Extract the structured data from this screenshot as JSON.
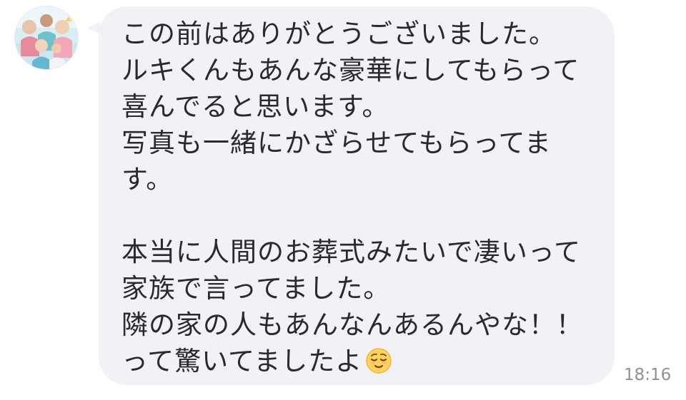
{
  "message": {
    "lines": [
      "この前はありがとうございました。",
      "ルキくんもあんな豪華にしてもらって",
      "喜んでると思います。",
      "写真も一緒にかざらせてもらってま",
      "す。",
      "",
      "本当に人間のお葬式みたいで凄いって",
      "家族で言ってました。",
      "隣の家の人もあんなんあるんやな！！",
      "って驚いてましたよ"
    ],
    "trailing_icon": "relieved-face-emoji",
    "timestamp": "18:16"
  },
  "colors": {
    "bubble": "#f1f2f5",
    "text": "#282a2e",
    "timestamp": "#8e9196",
    "background": "#ffffff"
  },
  "icons": {
    "avatar": "group-photo-avatar",
    "emoji": "relieved-face-emoji"
  }
}
